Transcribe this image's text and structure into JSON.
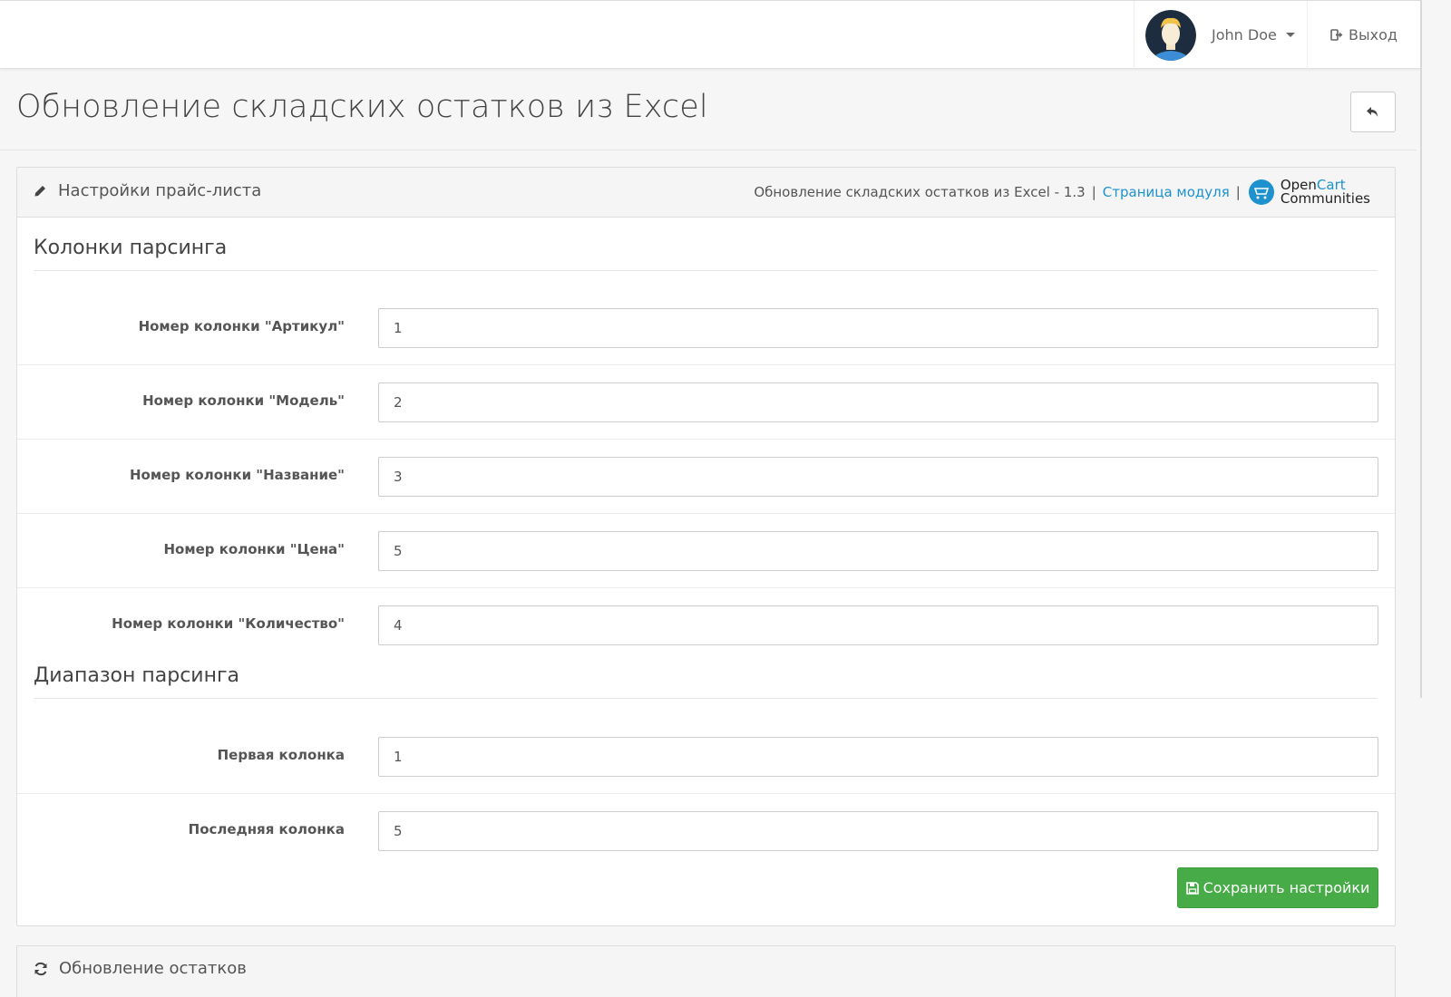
{
  "topbar": {
    "user_name": "John Doe",
    "logout_label": "Выход"
  },
  "page": {
    "title": "Обновление складских остатков из Excel"
  },
  "settings_panel": {
    "title": "Настройки прайс-листа",
    "module_version": "Обновление складских остатков из Excel - 1.3",
    "separator": "|",
    "module_link": "Страница модуля",
    "logo_open": "Open",
    "logo_cart": "Cart",
    "logo_communities": "Communities"
  },
  "sections": {
    "columns_title": "Колонки парсинга",
    "range_title": "Диапазон парсинга"
  },
  "fields": [
    {
      "label": "Номер колонки \"Артикул\"",
      "value": "1"
    },
    {
      "label": "Номер колонки \"Модель\"",
      "value": "2"
    },
    {
      "label": "Номер колонки \"Название\"",
      "value": "3"
    },
    {
      "label": "Номер колонки \"Цена\"",
      "value": "5"
    },
    {
      "label": "Номер колонки \"Количество\"",
      "value": "4"
    }
  ],
  "range_fields": [
    {
      "label": "Первая колонка",
      "value": "1"
    },
    {
      "label": "Последняя колонка",
      "value": "5"
    }
  ],
  "save_label": "Сохранить настройки",
  "update_panel": {
    "title": "Обновление остатков"
  },
  "colors": {
    "accent": "#1e91cf",
    "success": "#47ab47"
  }
}
